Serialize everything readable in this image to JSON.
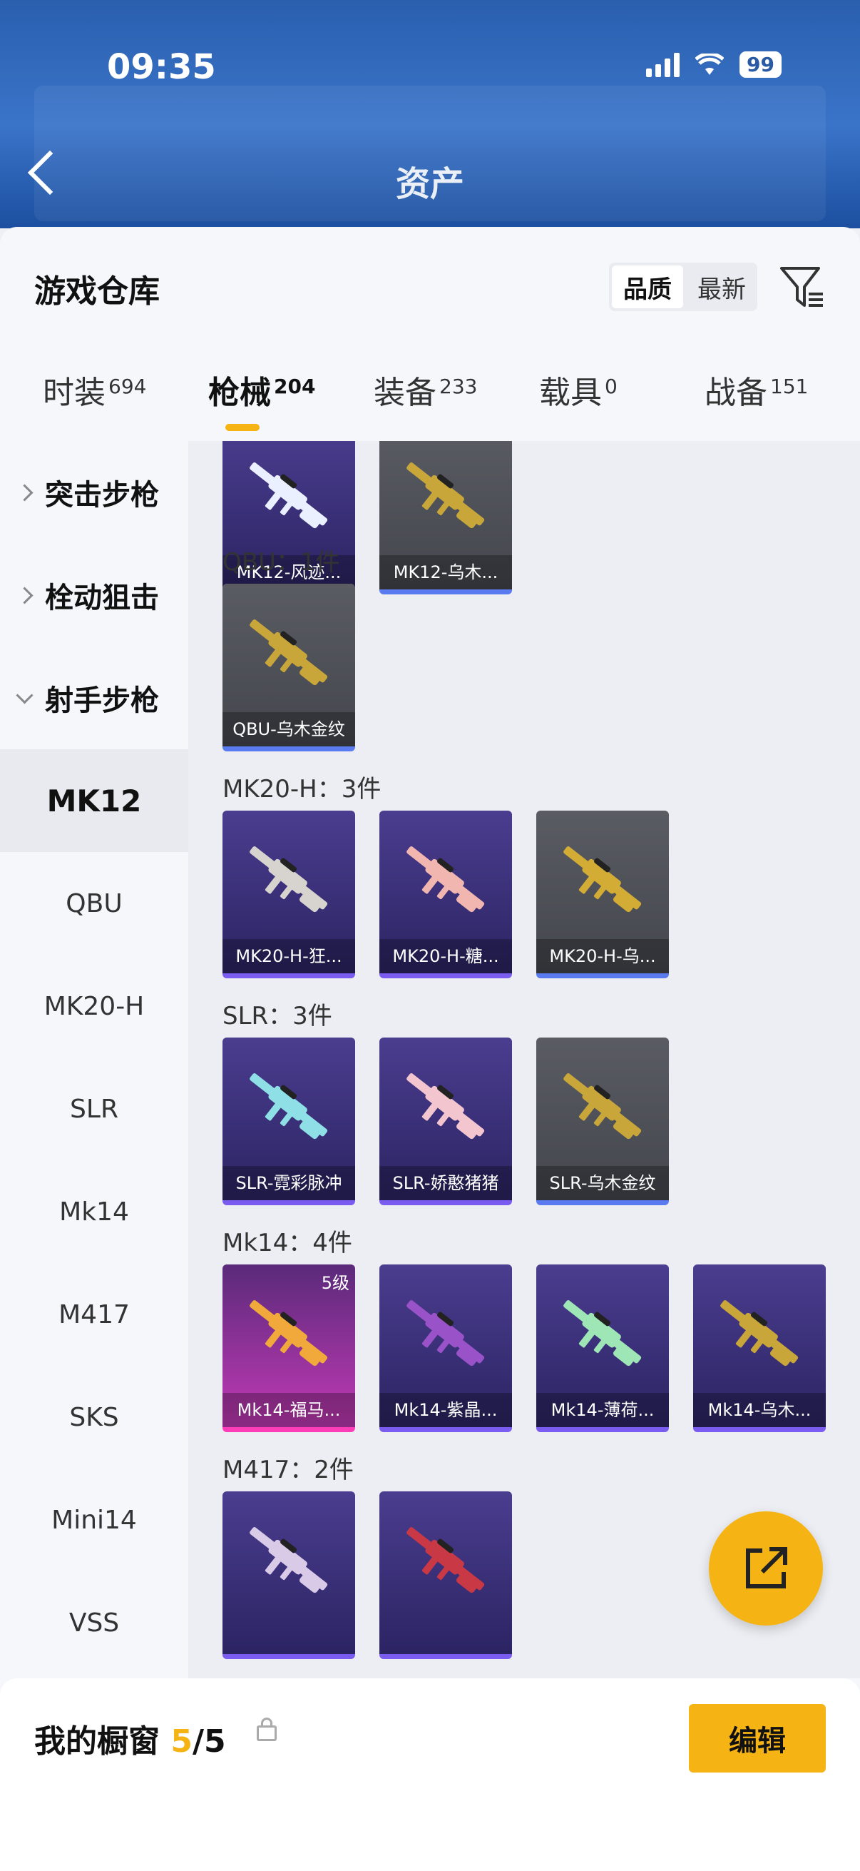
{
  "status": {
    "time": "09:35",
    "battery": "99"
  },
  "header": {
    "title": "资产"
  },
  "panel": {
    "title": "游戏仓库",
    "sort": {
      "options": [
        "品质",
        "最新"
      ],
      "active": "品质"
    },
    "tabs": [
      {
        "label": "时装",
        "count": "694"
      },
      {
        "label": "枪械",
        "count": "204"
      },
      {
        "label": "装备",
        "count": "233"
      },
      {
        "label": "载具",
        "count": "0"
      },
      {
        "label": "战备",
        "count": "151"
      }
    ]
  },
  "sidebar": {
    "groups": [
      "突击步枪",
      "栓动狙击",
      "射手步枪"
    ],
    "subitems": [
      "MK12",
      "QBU",
      "MK20-H",
      "SLR",
      "Mk14",
      "M417",
      "SKS",
      "Mini14",
      "VSS"
    ],
    "active_sub": "MK12"
  },
  "sections": [
    {
      "label": "",
      "items": [
        {
          "name": "MK12-风迹...",
          "rarity": "purple",
          "gun_color": "#eaf0ff"
        },
        {
          "name": "MK12-乌木...",
          "rarity": "gray",
          "gun_color": "#c8a63a"
        }
      ]
    },
    {
      "label": "QBU：1件",
      "items": [
        {
          "name": "QBU-乌木金纹",
          "rarity": "gray",
          "gun_color": "#c8a63a"
        }
      ]
    },
    {
      "label": "MK20-H：3件",
      "items": [
        {
          "name": "MK20-H-狂...",
          "rarity": "purple",
          "gun_color": "#d7d4d0"
        },
        {
          "name": "MK20-H-糖...",
          "rarity": "purple",
          "gun_color": "#f1b6b0"
        },
        {
          "name": "MK20-H-乌...",
          "rarity": "gray",
          "gun_color": "#d2ac35"
        }
      ]
    },
    {
      "label": "SLR：3件",
      "items": [
        {
          "name": "SLR-霓彩脉冲",
          "rarity": "purple",
          "gun_color": "#8ee0e6"
        },
        {
          "name": "SLR-娇憨猪猪",
          "rarity": "purple",
          "gun_color": "#f3c6cf"
        },
        {
          "name": "SLR-乌木金纹",
          "rarity": "gray",
          "gun_color": "#c8a63a"
        }
      ]
    },
    {
      "label": "Mk14：4件",
      "items": [
        {
          "name": "Mk14-福马...",
          "rarity": "pink",
          "gun_color": "#f2a93b",
          "level": "5级"
        },
        {
          "name": "Mk14-紫晶...",
          "rarity": "purple",
          "gun_color": "#9a52c9"
        },
        {
          "name": "Mk14-薄荷...",
          "rarity": "purple",
          "gun_color": "#9fe6b6"
        },
        {
          "name": "Mk14-乌木...",
          "rarity": "purple",
          "gun_color": "#c8a63a"
        }
      ]
    },
    {
      "label": "M417：2件",
      "items": [
        {
          "name": "",
          "rarity": "purple",
          "gun_color": "#d9cbe8"
        },
        {
          "name": "",
          "rarity": "purple",
          "gun_color": "#c83845"
        }
      ]
    }
  ],
  "bottom": {
    "title": "我的橱窗",
    "current": "5",
    "total": "/5",
    "edit_label": "编辑"
  }
}
